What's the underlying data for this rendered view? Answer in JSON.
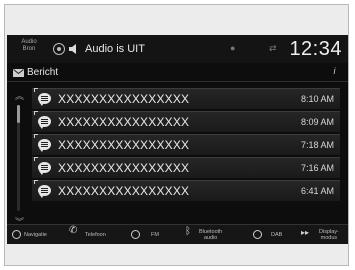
{
  "statusbar": {
    "audio_source_label": "Audio\nBron",
    "status_text": "Audio is UIT",
    "clock": "12:34"
  },
  "titlebar": {
    "title": "Bericht",
    "info_glyph": "i"
  },
  "messages": [
    {
      "sender": "XXXXXXXXXXXXXXXX",
      "time": "8:10 AM"
    },
    {
      "sender": "XXXXXXXXXXXXXXXX",
      "time": "8:09 AM"
    },
    {
      "sender": "XXXXXXXXXXXXXXXX",
      "time": "7:18 AM"
    },
    {
      "sender": "XXXXXXXXXXXXXXXX",
      "time": "7:16 AM"
    },
    {
      "sender": "XXXXXXXXXXXXXXXX",
      "time": "6:41 AM"
    }
  ],
  "bottombar": {
    "navigation": "Navigatie",
    "phone": "Telefoon",
    "fm": "FM",
    "bluetooth_line1": "Bluetooth",
    "bluetooth_line2": "audio",
    "dab": "DAB",
    "display_line1": "Display-",
    "display_line2": "modus"
  },
  "colors": {
    "screen_bg": "#0d0d0d",
    "row_bg": "#1f1f1f",
    "text": "#eaeaea"
  }
}
